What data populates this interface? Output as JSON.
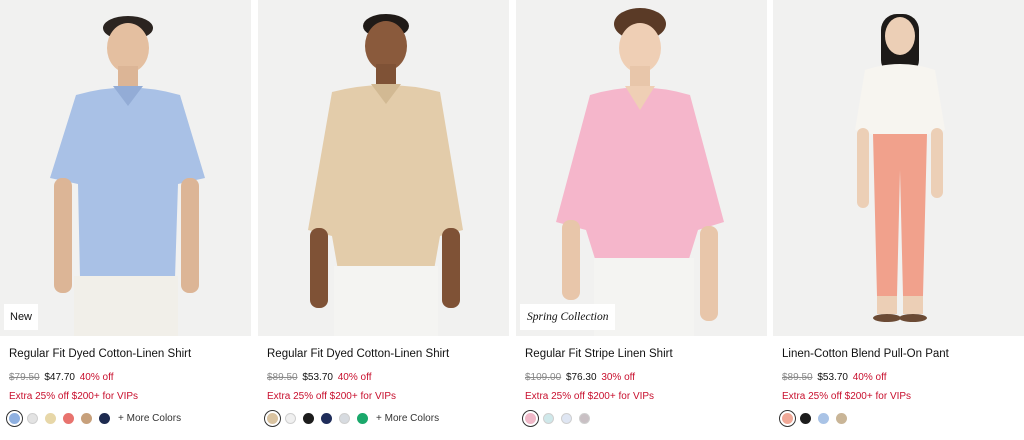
{
  "products": [
    {
      "badge": "New",
      "name": "Regular Fit Dyed Cotton-Linen Shirt",
      "original_price": "$79.50",
      "sale_price": "$47.70",
      "discount": "40% off",
      "promo": "Extra 25% off $200+ for VIPs",
      "swatches": [
        "#8fb0e0",
        "#e3e3e3",
        "#e7d7a8",
        "#e8736e",
        "#c7a07b",
        "#1d2a4f"
      ],
      "more_colors": "+ More Colors",
      "colors": {
        "shirt": "#a9c1e6",
        "pants": "#f1efe9"
      }
    },
    {
      "badge": "",
      "name": "Regular Fit Dyed Cotton-Linen Shirt",
      "original_price": "$89.50",
      "sale_price": "$53.70",
      "discount": "40% off",
      "promo": "Extra 25% off $200+ for VIPs",
      "swatches": [
        "#d9c3a1",
        "#f0f0f0",
        "#1c1c1c",
        "#1f2d5a",
        "#d7dbe0",
        "#1aa86b"
      ],
      "more_colors": "+ More Colors",
      "colors": {
        "shirt": "#e3ccaa",
        "pants": "#f4f4f2"
      }
    },
    {
      "badge": "Spring Collection",
      "name": "Regular Fit Stripe Linen Shirt",
      "original_price": "$109.00",
      "sale_price": "$76.30",
      "discount": "30% off",
      "promo": "Extra 25% off $200+ for VIPs",
      "swatches": [
        "#f0b8c8",
        "#cfe8ea",
        "#dfe6f3",
        "#c9c0c4"
      ],
      "more_colors": "",
      "colors": {
        "shirt": "#f5b6cb",
        "pants": "#f4f4f2"
      }
    },
    {
      "badge": "",
      "name": "Linen-Cotton Blend Pull-On Pant",
      "original_price": "$89.50",
      "sale_price": "$53.70",
      "discount": "40% off",
      "promo": "Extra 25% off $200+ for VIPs",
      "swatches": [
        "#f0a897",
        "#1c1c1c",
        "#a9c3e6",
        "#c9b597"
      ],
      "more_colors": "",
      "colors": {
        "shirt": "#f7f5f0",
        "pants": "#f1a18c"
      }
    }
  ],
  "ui_colors": {
    "sale_red": "#c8102e",
    "strike_gray": "#8a8a8a",
    "photo_bg": "#f1f1f0"
  }
}
